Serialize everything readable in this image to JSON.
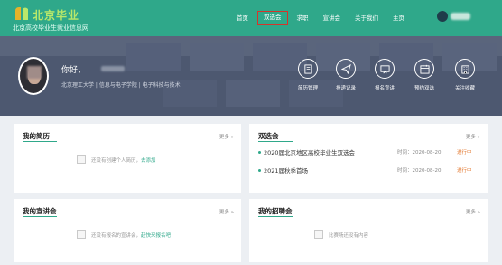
{
  "app": {
    "logo_text": "北京毕业",
    "logo_sub": "北京高校毕业生就业信息网",
    "brand_color": "#2fa88a",
    "accent_color": "#d6342b"
  },
  "nav": {
    "items": [
      "首页",
      "双选会",
      "求职",
      "宣讲会",
      "关于我们",
      "主页"
    ],
    "active_index": 1
  },
  "profile": {
    "greeting": "你好，",
    "school_line": "北京理工大学 | 信息与电子学院 | 电子科技与技术"
  },
  "quick_links": [
    {
      "label": "简历管理",
      "icon": "resume-icon"
    },
    {
      "label": "投递记录",
      "icon": "send-icon"
    },
    {
      "label": "报名宣讲",
      "icon": "presentation-icon"
    },
    {
      "label": "预约双选",
      "icon": "calendar-icon"
    },
    {
      "label": "关注收藏",
      "icon": "building-icon"
    }
  ],
  "cards": {
    "resume": {
      "title": "我的简历",
      "more": "更多 »",
      "empty_text": "还没有创建个人简历，",
      "empty_link": "去添加"
    },
    "fair": {
      "title": "双选会",
      "more": "更多 »",
      "items": [
        {
          "name": "2020届北京地区高校毕业生双选会",
          "time": "时间：2020-08-20",
          "status": "进行中"
        },
        {
          "name": "2021届秋季首场",
          "time": "时间：2020-08-20",
          "status": "进行中"
        }
      ]
    },
    "talk": {
      "title": "我的宣讲会",
      "more": "更多 »",
      "empty_text": "还没有报名的宣讲会，",
      "empty_link": "赶快来报名吧"
    },
    "recruit": {
      "title": "我的招聘会",
      "more": "更多 »",
      "empty_text": "比赛场还没有内容"
    }
  }
}
